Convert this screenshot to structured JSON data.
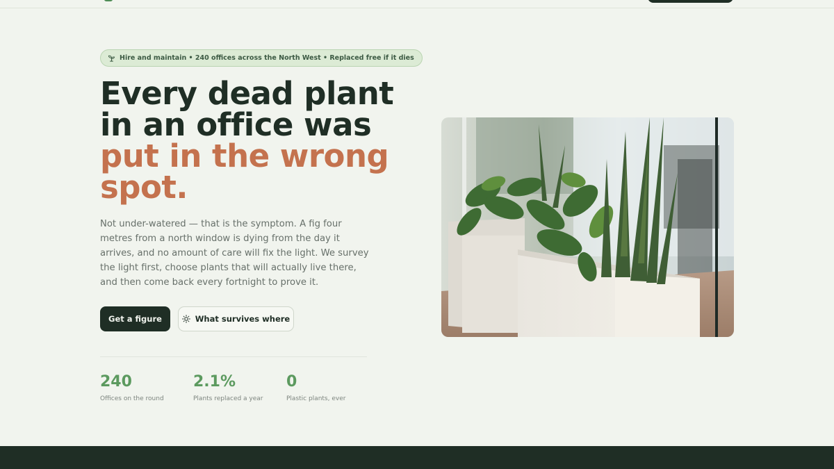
{
  "hero": {
    "eyebrow_text": "Hire and maintain • 240 offices across the North West • Replaced free if it dies",
    "headline_line1": "Every dead plant",
    "headline_line2": "in an office was",
    "headline_accent_line1": "put in the wrong",
    "headline_accent_line2": "spot.",
    "lede": "Not under-watered — that is the symptom. A fig four metres from a north window is dying from the day it arrives, and no amount of care will fix the light. We survey the light first, choose plants that will actually live there, and then come back every fortnight to prove it.",
    "primary_cta": "Get a figure",
    "secondary_cta": "What survives where"
  },
  "stats": [
    {
      "value": "240",
      "label": "Offices on the round"
    },
    {
      "value": "2.1%",
      "label": "Plants replaced a year"
    },
    {
      "value": "0",
      "label": "Plastic plants, ever"
    }
  ],
  "icons": {
    "eyebrow": "sprout-icon",
    "secondary_cta": "sun-icon"
  },
  "colors": {
    "background": "#f1f4ee",
    "ink": "#1f2e25",
    "accent": "#c4724e",
    "stat_green": "#5c9a5f"
  }
}
